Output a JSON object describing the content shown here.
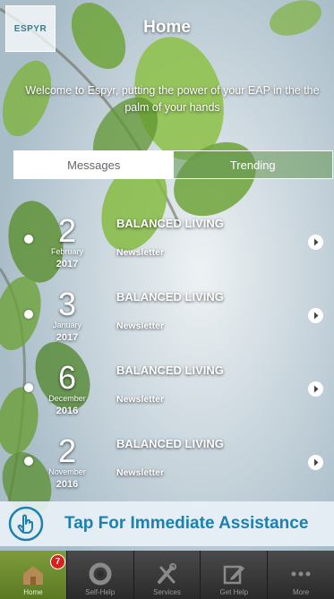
{
  "header": {
    "logo_text": "ESPYR",
    "title": "Home"
  },
  "welcome_text": "Welcome to Espyr, putting the power of your EAP in the the palm of your hands",
  "tabs": [
    {
      "label": "Messages",
      "active": true
    },
    {
      "label": "Trending",
      "active": false
    }
  ],
  "news": [
    {
      "day": "2",
      "month": "February",
      "year": "2017",
      "title": "BALANCED LIVING",
      "subtitle": "Newsletter"
    },
    {
      "day": "3",
      "month": "January",
      "year": "2017",
      "title": "BALANCED LIVING",
      "subtitle": "Newsletter"
    },
    {
      "day": "6",
      "month": "December",
      "year": "2016",
      "title": "BALANCED LIVING",
      "subtitle": "Newsletter"
    },
    {
      "day": "2",
      "month": "November",
      "year": "2016",
      "title": "BALANCED LIVING",
      "subtitle": "Newsletter"
    }
  ],
  "assist": {
    "label": "Tap For Immediate Assistance",
    "icon": "hand-pointer-icon"
  },
  "tabbar": {
    "items": [
      {
        "label": "Home",
        "icon": "home-icon",
        "badge": "7",
        "active": true
      },
      {
        "label": "Self-Help",
        "icon": "lifebuoy-icon",
        "active": false
      },
      {
        "label": "Services",
        "icon": "tools-icon",
        "active": false
      },
      {
        "label": "Get Help",
        "icon": "edit-icon",
        "active": false
      },
      {
        "label": "More",
        "icon": "more-icon",
        "active": false
      }
    ]
  },
  "colors": {
    "accent_blue": "#1e80b0",
    "active_tab_green": "#6d8c2e",
    "badge_red": "#d9201c"
  }
}
